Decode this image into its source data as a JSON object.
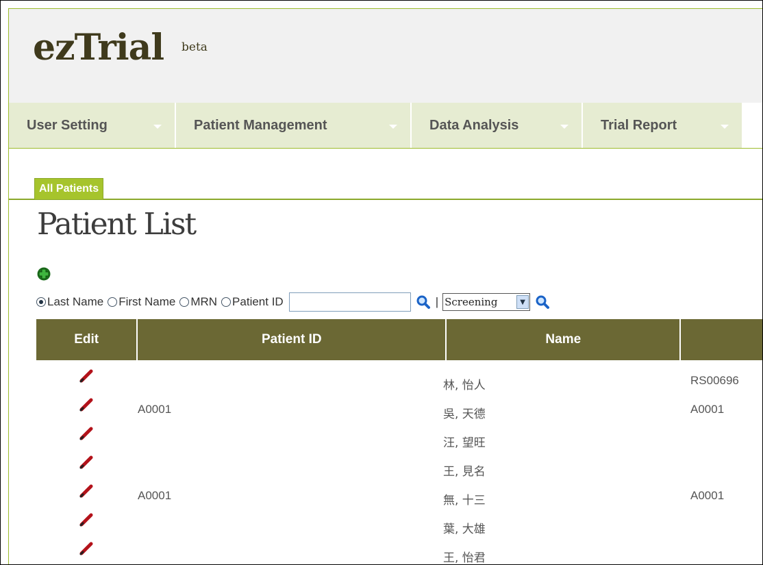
{
  "app": {
    "logo": "ezTrial",
    "badge": "beta"
  },
  "nav": [
    {
      "label": "User Setting"
    },
    {
      "label": "Patient Management"
    },
    {
      "label": "Data Analysis"
    },
    {
      "label": "Trial Report"
    }
  ],
  "tabs": {
    "active": "All Patients"
  },
  "page": {
    "title": "Patient List"
  },
  "search": {
    "options": [
      "Last Name",
      "First Name",
      "MRN",
      "Patient ID"
    ],
    "selected_option": "Last Name",
    "input_value": "",
    "separator": "|",
    "status_selected": "Screening"
  },
  "table": {
    "headers": {
      "edit": "Edit",
      "patient_id": "Patient ID",
      "name": "Name",
      "fourth": ""
    },
    "rows": [
      {
        "patient_id": "",
        "name": "林, 怡人",
        "mrn": "RS00696"
      },
      {
        "patient_id": "A0001",
        "name": "吳, 天德",
        "mrn": "A0001"
      },
      {
        "patient_id": "",
        "name": "汪, 望旺",
        "mrn": ""
      },
      {
        "patient_id": "",
        "name": "王, 見名",
        "mrn": ""
      },
      {
        "patient_id": "A0001",
        "name": "無, 十三",
        "mrn": "A0001"
      },
      {
        "patient_id": "",
        "name": "葉, 大雄",
        "mrn": ""
      },
      {
        "patient_id": "",
        "name": "王, 怡君",
        "mrn": ""
      }
    ]
  },
  "icons": {
    "add": "add-patient-icon",
    "search": "magnifier-icon",
    "edit": "pencil-icon"
  },
  "colors": {
    "accent": "#a6c42c",
    "nav_bg": "#e6ecd2",
    "table_header": "#6b6834",
    "logo": "#3f3a1c"
  }
}
